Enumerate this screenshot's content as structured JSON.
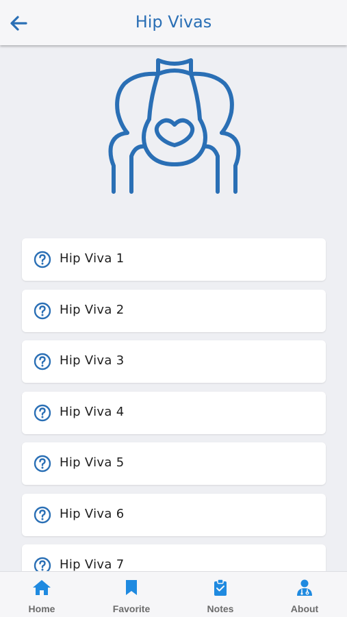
{
  "header": {
    "title": "Hip Vivas"
  },
  "list": {
    "items": [
      {
        "label": "Hip Viva 1"
      },
      {
        "label": "Hip Viva 2"
      },
      {
        "label": "Hip Viva 3"
      },
      {
        "label": "Hip Viva 4"
      },
      {
        "label": "Hip Viva 5"
      },
      {
        "label": "Hip Viva 6"
      },
      {
        "label": "Hip Viva 7"
      }
    ]
  },
  "bottom_nav": {
    "items": [
      {
        "label": "Home",
        "icon": "home-icon"
      },
      {
        "label": "Favorite",
        "icon": "bookmark-icon"
      },
      {
        "label": "Notes",
        "icon": "clipboard-icon"
      },
      {
        "label": "About",
        "icon": "doctor-icon"
      }
    ]
  },
  "colors": {
    "accent": "#2a6fb5",
    "background": "#eeeff3",
    "card": "#ffffff"
  }
}
